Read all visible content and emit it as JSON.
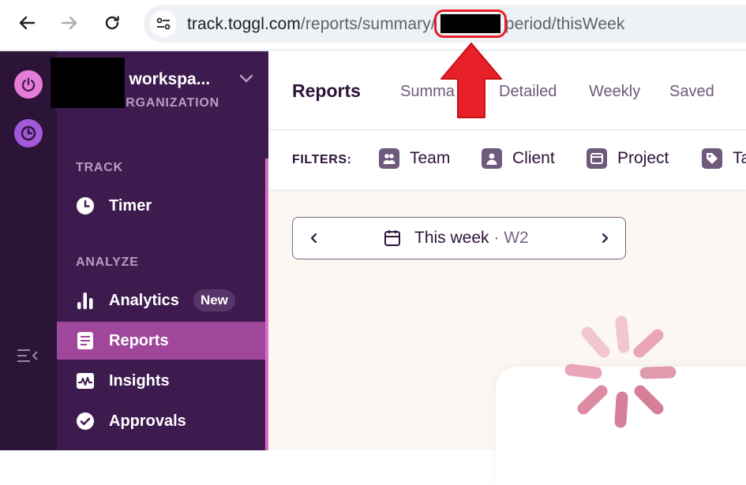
{
  "browser": {
    "url_domain": "track.toggl.com",
    "url_path_start": "/reports/summary/",
    "url_path_end": "period/thisWeek"
  },
  "sidebar": {
    "workspace_name": "s workspa...",
    "workspace_sub": "ORGANIZATION",
    "sections": {
      "track": "TRACK",
      "analyze": "ANALYZE"
    },
    "items": {
      "timer": "Timer",
      "analytics": "Analytics",
      "analytics_badge": "New",
      "reports": "Reports",
      "insights": "Insights",
      "approvals": "Approvals"
    }
  },
  "header": {
    "title": "Reports",
    "tabs": {
      "summary": "Summa",
      "detailed": "Detailed",
      "weekly": "Weekly",
      "saved": "Saved"
    }
  },
  "filters": {
    "label": "FILTERS:",
    "team": "Team",
    "client": "Client",
    "project": "Project",
    "tag": "Ta"
  },
  "date_picker": {
    "label": "This week",
    "separator": "·",
    "week": "W2"
  },
  "colors": {
    "rail": "#2c1338",
    "sidebar": "#3d1b4e",
    "active_item": "#a0479b",
    "annotation_red": "#e8202a",
    "spinner": "#e092a8"
  }
}
